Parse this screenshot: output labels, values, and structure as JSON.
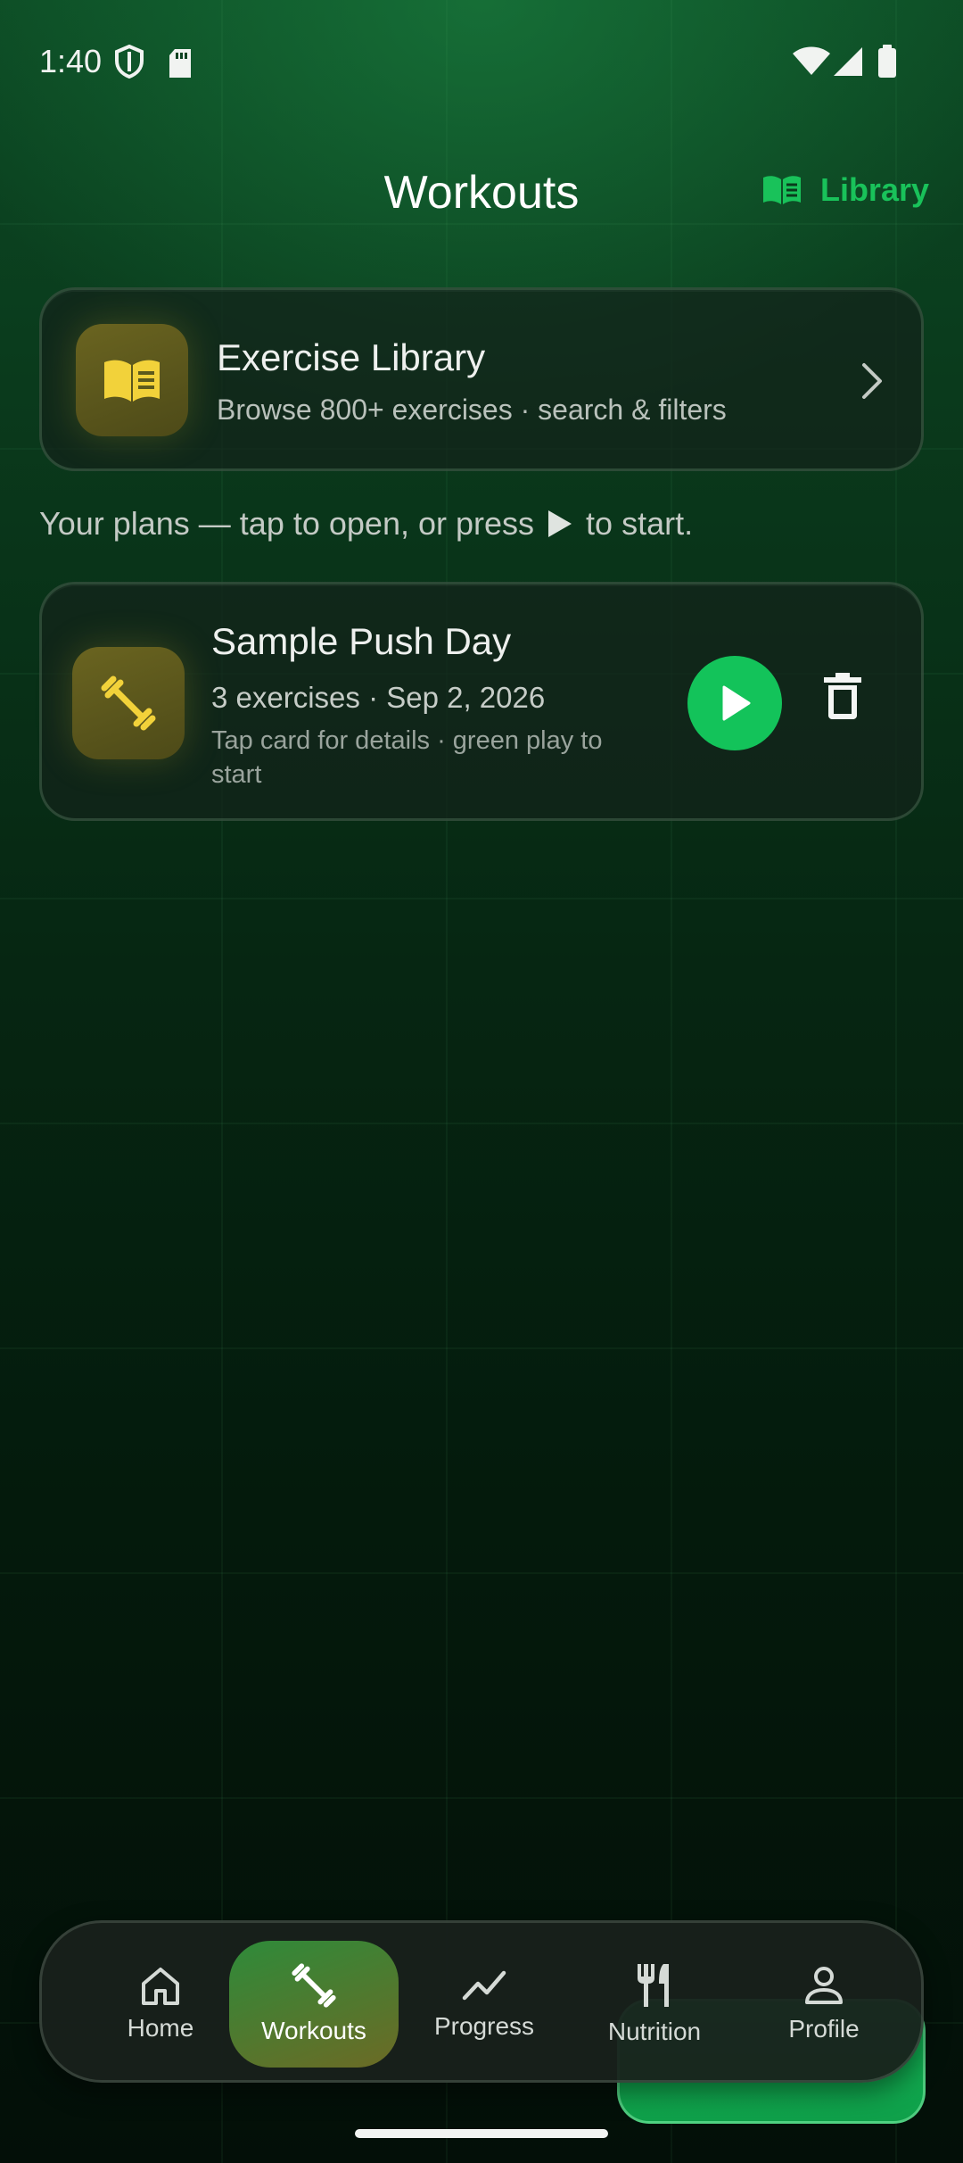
{
  "status_bar": {
    "time": "1:40"
  },
  "header": {
    "title": "Workouts",
    "library_label": "Library"
  },
  "library_card": {
    "title": "Exercise Library",
    "subtitle": "Browse 800+ exercises · search & filters"
  },
  "hint": {
    "before": "Your plans — tap to open, or press",
    "after": "to start."
  },
  "plans": [
    {
      "title": "Sample Push Day",
      "meta": "3 exercises · Sep 2, 2026",
      "hint": "Tap card for details · green play to start"
    }
  ],
  "nav": {
    "items": [
      {
        "label": "Home",
        "icon": "home-icon"
      },
      {
        "label": "Workouts",
        "icon": "dumbbell-icon",
        "active": true
      },
      {
        "label": "Progress",
        "icon": "trend-icon"
      },
      {
        "label": "Nutrition",
        "icon": "utensils-icon"
      },
      {
        "label": "Profile",
        "icon": "person-icon"
      }
    ]
  },
  "colors": {
    "accent": "#13c35a",
    "tile": "#5c5a1c",
    "tile_icon": "#f2d23a",
    "background": "#062612"
  }
}
